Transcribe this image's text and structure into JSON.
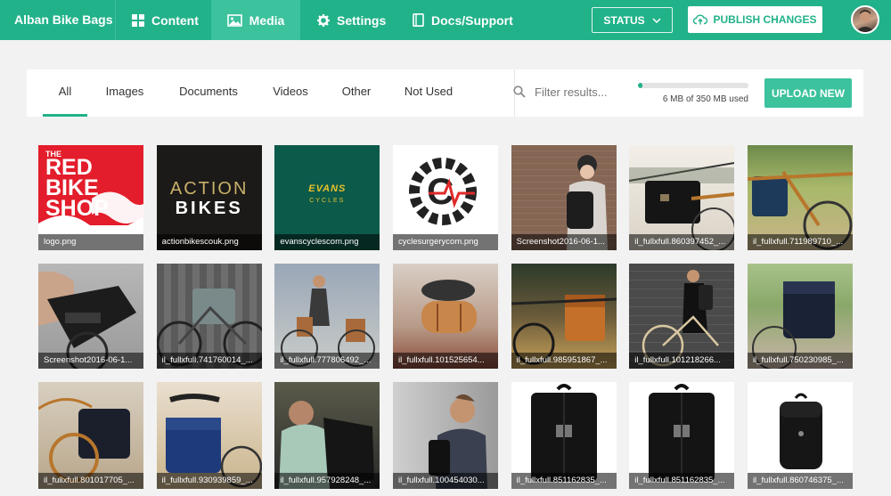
{
  "header": {
    "brand": "Alban Bike Bags",
    "nav": [
      {
        "label": "Content",
        "icon": "grid-icon",
        "active": false
      },
      {
        "label": "Media",
        "icon": "image-icon",
        "active": true
      },
      {
        "label": "Settings",
        "icon": "gear-icon",
        "active": false
      },
      {
        "label": "Docs/Support",
        "icon": "book-icon",
        "active": false
      }
    ],
    "status_label": "STATUS",
    "publish_label": "PUBLISH CHANGES"
  },
  "filters": {
    "tabs": [
      "All",
      "Images",
      "Documents",
      "Videos",
      "Other",
      "Not Used"
    ],
    "active_tab": "All",
    "search_placeholder": "Filter results...",
    "storage_text": "6 MB of 350 MB used",
    "storage_used_mb": 6,
    "storage_total_mb": 350,
    "upload_label": "UPLOAD NEW"
  },
  "colors": {
    "brand": "#22b28a",
    "brand_light": "#3cc29d"
  },
  "media": [
    {
      "name": "logo.png",
      "logo_lines": [
        "THE",
        "RED",
        "BIKE",
        "SHOP"
      ]
    },
    {
      "name": "actionbikescouk.png",
      "logo_lines": [
        "ACTION",
        "BIKES"
      ]
    },
    {
      "name": "evanscyclescom.png",
      "logo_lines": [
        "EVANS",
        "CYCLES"
      ]
    },
    {
      "name": "cyclesurgerycom.png"
    },
    {
      "name": "Screenshot2016-06-1..."
    },
    {
      "name": "il_fullxfull.860397452_..."
    },
    {
      "name": "il_fullxfull.711989710_..."
    },
    {
      "name": "Screenshot2016-06-1..."
    },
    {
      "name": "il_fullxfull.741760014_..."
    },
    {
      "name": "il_fullxfull.777806492_..."
    },
    {
      "name": "il_fullxfull.101525654..."
    },
    {
      "name": "il_fullxfull.985951867_..."
    },
    {
      "name": "il_fullxfull.101218266..."
    },
    {
      "name": "il_fullxfull.750230985_..."
    },
    {
      "name": "il_fullxfull.801017705_..."
    },
    {
      "name": "il_fullxfull.930939859_..."
    },
    {
      "name": "il_fullxfull.957928248_..."
    },
    {
      "name": "il_fullxfull.100454030..."
    },
    {
      "name": "il_fullxfull.851162835_..."
    },
    {
      "name": "il_fullxfull.851162835_..."
    },
    {
      "name": "il_fullxfull.860746375_..."
    }
  ]
}
